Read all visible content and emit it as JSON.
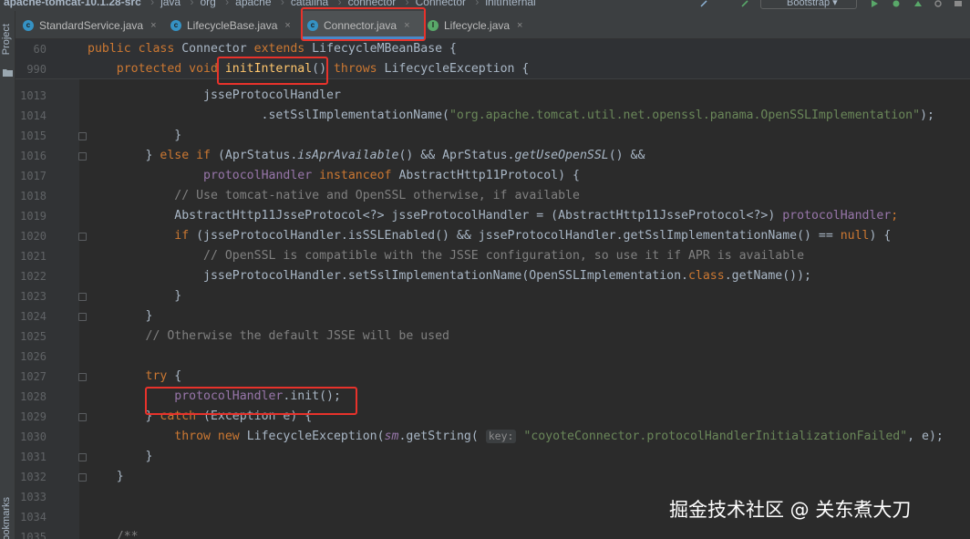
{
  "breadcrumb": {
    "project": "apache-tomcat-10.1.28-src",
    "items": [
      "java",
      "org",
      "apache",
      "catalina",
      "connector",
      "Connector",
      "initInternal"
    ]
  },
  "run_config": {
    "label": "Bootstrap"
  },
  "tool_windows": {
    "project": "Project",
    "bookmarks": "Bookmarks"
  },
  "tabs": [
    {
      "label": "StandardService.java",
      "close": "×"
    },
    {
      "label": "LifecycleBase.java",
      "close": "×"
    },
    {
      "label": "Connector.java",
      "close": "×"
    },
    {
      "label": "Lifecycle.java",
      "close": "×"
    }
  ],
  "colors": {
    "keyword": "#cc7832",
    "comment": "#808080",
    "string": "#6a8759",
    "method": "#ffc66d",
    "field": "#9876aa",
    "highlight_box": "#e8322b",
    "active_tab_underline": "#4a88c7"
  },
  "sticky_lines": [
    {
      "num": "60",
      "tokens": [
        [
          "kw",
          "public class "
        ],
        [
          "",
          "Connector "
        ],
        [
          "kw",
          "extends "
        ],
        [
          "",
          "LifecycleMBeanBase {"
        ]
      ]
    },
    {
      "num": "990",
      "tokens": [
        [
          "",
          "    "
        ],
        [
          "kw",
          "protected void "
        ],
        [
          "fn",
          "initInternal"
        ],
        [
          "",
          "() "
        ],
        [
          "kw",
          "throws "
        ],
        [
          "",
          "LifecycleException {"
        ]
      ]
    }
  ],
  "code_lines": [
    {
      "num": "1013",
      "tokens": [
        [
          "",
          "                "
        ],
        [
          "",
          "jsseProtocolHandler"
        ]
      ]
    },
    {
      "num": "1014",
      "tokens": [
        [
          "",
          "                        .setSslImplementationName("
        ],
        [
          "st",
          "\"org.apache.tomcat.util.net.openssl.panama.OpenSSLImplementation\""
        ],
        [
          "",
          ");"
        ]
      ]
    },
    {
      "num": "1015",
      "tokens": [
        [
          "",
          "            }"
        ]
      ]
    },
    {
      "num": "1016",
      "tokens": [
        [
          "",
          "        } "
        ],
        [
          "kw",
          "else if "
        ],
        [
          "",
          "(AprStatus."
        ],
        [
          "it",
          "isAprAvailable"
        ],
        [
          "",
          "() && AprStatus."
        ],
        [
          "it",
          "getUseOpenSSL"
        ],
        [
          "",
          "() &&"
        ]
      ]
    },
    {
      "num": "1017",
      "tokens": [
        [
          "",
          "                "
        ],
        [
          "fld",
          "protocolHandler "
        ],
        [
          "kw",
          "instanceof "
        ],
        [
          "",
          "AbstractHttp11Protocol) {"
        ]
      ]
    },
    {
      "num": "1018",
      "tokens": [
        [
          "",
          "            "
        ],
        [
          "cm",
          "// Use tomcat-native and OpenSSL otherwise, if available"
        ]
      ]
    },
    {
      "num": "1019",
      "tokens": [
        [
          "",
          "            AbstractHttp11JsseProtocol<?> jsseProtocolHandler = (AbstractHttp11JsseProtocol<?>) "
        ],
        [
          "fld",
          "protocolHandler"
        ],
        [
          "kw",
          ";"
        ]
      ]
    },
    {
      "num": "1020",
      "tokens": [
        [
          "",
          "            "
        ],
        [
          "kw",
          "if "
        ],
        [
          "",
          "(jsseProtocolHandler.isSSLEnabled() && jsseProtocolHandler.getSslImplementationName() == "
        ],
        [
          "kw",
          "null"
        ],
        [
          "",
          ") {"
        ]
      ]
    },
    {
      "num": "1021",
      "tokens": [
        [
          "",
          "                "
        ],
        [
          "cm",
          "// OpenSSL is compatible with the JSSE configuration, so use it if APR is available"
        ]
      ]
    },
    {
      "num": "1022",
      "tokens": [
        [
          "",
          "                jsseProtocolHandler.setSslImplementationName(OpenSSLImplementation."
        ],
        [
          "kw",
          "class"
        ],
        [
          "",
          ".getName());"
        ]
      ]
    },
    {
      "num": "1023",
      "tokens": [
        [
          "",
          "            }"
        ]
      ]
    },
    {
      "num": "1024",
      "tokens": [
        [
          "",
          "        }"
        ]
      ]
    },
    {
      "num": "1025",
      "tokens": [
        [
          "",
          "        "
        ],
        [
          "cm",
          "// Otherwise the default JSSE will be used"
        ]
      ]
    },
    {
      "num": "1026",
      "tokens": []
    },
    {
      "num": "1027",
      "tokens": [
        [
          "",
          "        "
        ],
        [
          "kw",
          "try "
        ],
        [
          "",
          "{"
        ]
      ]
    },
    {
      "num": "1028",
      "tokens": [
        [
          "",
          "            "
        ],
        [
          "fld",
          "protocolHandler"
        ],
        [
          "",
          ".init();"
        ]
      ]
    },
    {
      "num": "1029",
      "tokens": [
        [
          "",
          "        } "
        ],
        [
          "kw",
          "catch "
        ],
        [
          "",
          "(Exception e) {"
        ]
      ]
    },
    {
      "num": "1030",
      "tokens": [
        [
          "",
          "            "
        ],
        [
          "kw",
          "throw new "
        ],
        [
          "",
          "LifecycleException("
        ],
        [
          "fld it",
          "sm"
        ],
        [
          "",
          ".getString( "
        ],
        [
          "hint",
          "key:"
        ],
        [
          "",
          " "
        ],
        [
          "st",
          "\"coyoteConnector.protocolHandlerInitializationFailed\""
        ],
        [
          "",
          ", e);"
        ]
      ]
    },
    {
      "num": "1031",
      "tokens": [
        [
          "",
          "        }"
        ]
      ]
    },
    {
      "num": "1032",
      "tokens": [
        [
          "",
          "    }"
        ]
      ]
    },
    {
      "num": "1033",
      "tokens": []
    },
    {
      "num": "1034",
      "tokens": []
    },
    {
      "num": "1035",
      "tokens": [
        [
          "",
          "    "
        ],
        [
          "cm",
          "/**"
        ]
      ]
    }
  ],
  "watermark": "掘金技术社区 @ 关东煮大刀"
}
